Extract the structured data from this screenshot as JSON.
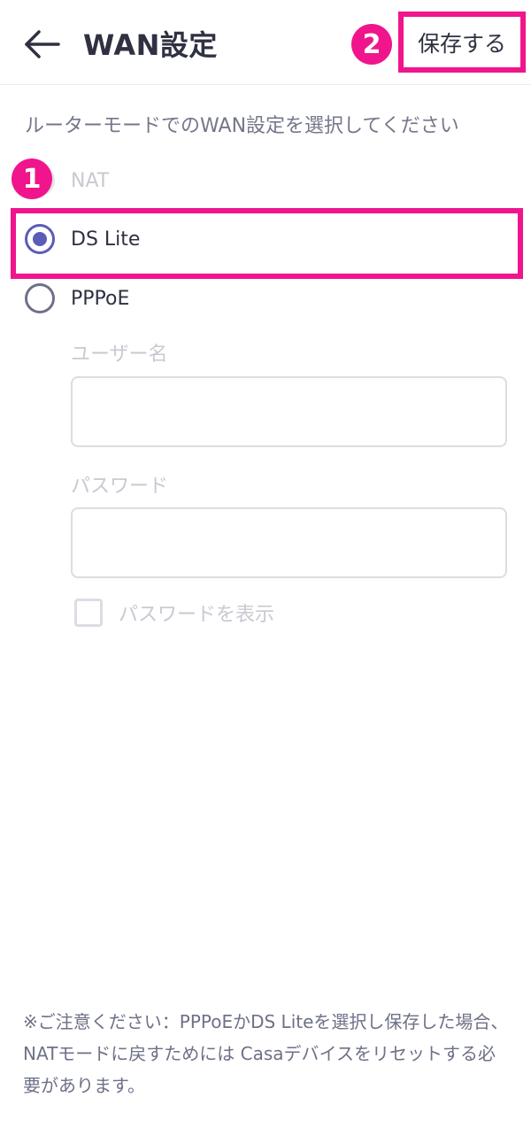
{
  "header": {
    "title": "WAN設定",
    "save_label": "保存する",
    "back_icon": "arrow-left-icon"
  },
  "markers": {
    "one": "1",
    "two": "2"
  },
  "description": "ルーターモードでのWAN設定を選択してください",
  "options": [
    {
      "label": "NAT",
      "selected": false,
      "disabled": true
    },
    {
      "label": "DS Lite",
      "selected": true,
      "disabled": false
    },
    {
      "label": "PPPoE",
      "selected": false,
      "disabled": false
    }
  ],
  "pppoe": {
    "username_label": "ユーザー名",
    "username_value": "",
    "password_label": "パスワード",
    "password_value": "",
    "show_password_label": "パスワードを表示",
    "show_password_checked": false
  },
  "notice": "※ご注意ください：PPPoEかDS Liteを選択し保存した場合、NATモードに戻すためには Casaデバイスをリセットする必要があります。",
  "colors": {
    "accent": "#5a5cb8",
    "highlight": "#f0158c",
    "text": "#2f3142",
    "muted": "#74778a",
    "disabled": "#c8c9d2"
  }
}
